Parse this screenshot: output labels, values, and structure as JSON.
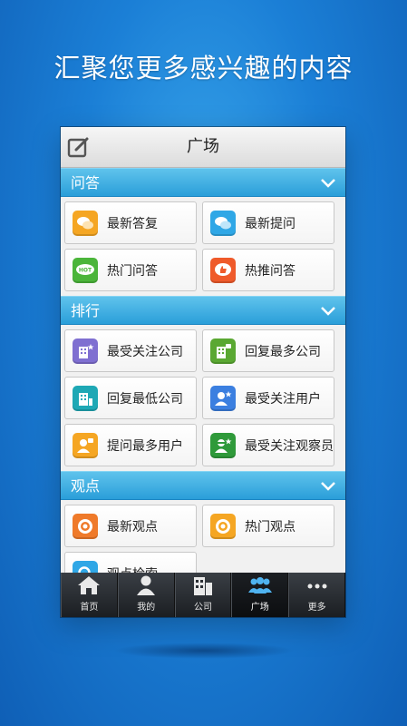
{
  "headline": "汇聚您更多感兴趣的内容",
  "titlebar": {
    "title": "广场",
    "edit_icon": "edit-icon"
  },
  "sections": [
    {
      "title": "问答",
      "items": [
        {
          "label": "最新答复",
          "icon": "chat-bubbles-icon",
          "color": "#f5a623"
        },
        {
          "label": "最新提问",
          "icon": "chat-bubbles-icon",
          "color": "#2fa7e6"
        },
        {
          "label": "热门问答",
          "icon": "hot-bubble-icon",
          "color": "#4bb53a",
          "icon_text": "HOT"
        },
        {
          "label": "热推问答",
          "icon": "thumbs-up-icon",
          "color": "#ef5a2a"
        }
      ]
    },
    {
      "title": "排行",
      "items": [
        {
          "label": "最受关注公司",
          "icon": "building-star-icon",
          "color": "#7f6fd1"
        },
        {
          "label": "回复最多公司",
          "icon": "building-chat-icon",
          "color": "#5aa832"
        },
        {
          "label": "回复最低公司",
          "icon": "building-icon",
          "color": "#1ea8b5"
        },
        {
          "label": "最受关注用户",
          "icon": "user-star-icon",
          "color": "#3b7fe0"
        },
        {
          "label": "提问最多用户",
          "icon": "user-question-icon",
          "color": "#f5a623"
        },
        {
          "label": "最受关注观察员",
          "icon": "observer-star-icon",
          "color": "#2f9a3a"
        }
      ]
    },
    {
      "title": "观点",
      "items": [
        {
          "label": "最新观点",
          "icon": "target-icon",
          "color": "#ef7a2a"
        },
        {
          "label": "热门观点",
          "icon": "target-icon",
          "color": "#f5a623"
        },
        {
          "label": "观点检索",
          "icon": "search-icon",
          "color": "#2fa7e6"
        }
      ]
    }
  ],
  "tabs": [
    {
      "label": "首页",
      "icon": "home-icon",
      "active": false
    },
    {
      "label": "我的",
      "icon": "person-icon",
      "active": false
    },
    {
      "label": "公司",
      "icon": "building-icon",
      "active": false
    },
    {
      "label": "广场",
      "icon": "group-icon",
      "active": true
    },
    {
      "label": "更多",
      "icon": "more-dots-icon",
      "active": false
    }
  ]
}
